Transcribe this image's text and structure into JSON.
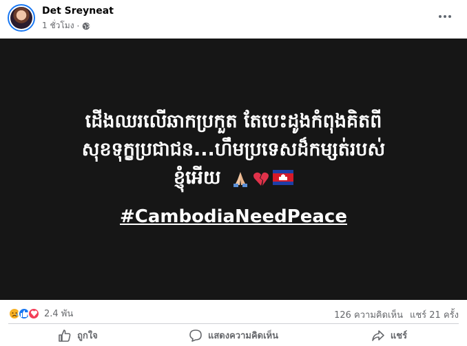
{
  "post": {
    "author": "Det Sreyneat",
    "time": "1 ชั่วโมง",
    "separator": "·",
    "privacy_icon": "globe-icon",
    "more_icon": "more-options-icon",
    "text_line1": "ដើងឈរលើឆាកប្រកួត តែបេះដូងកំពុងគិតពី",
    "text_line2": "សុខទុក្ខប្រជាជន...ហឹមប្រទេសដ៏កម្សត់របស់",
    "text_line3": "ខ្ញុំអើយ",
    "emojis": [
      "folded-hands",
      "broken-heart",
      "cambodia-flag"
    ],
    "hashtag": "#CambodiaNeedPeace",
    "background_color": "#161616"
  },
  "stats": {
    "reaction_icons": [
      "sad-reaction-icon",
      "like-reaction-icon",
      "love-reaction-icon"
    ],
    "reaction_count": "2.4 พัน",
    "comments": "126 ความคิดเห็น",
    "shares": "แชร์ 21 ครั้ง"
  },
  "actions": {
    "like": "ถูกใจ",
    "comment": "แสดงความคิดเห็น",
    "share": "แชร์"
  },
  "colors": {
    "accent": "#1877f2",
    "secondary_text": "#65676b"
  }
}
